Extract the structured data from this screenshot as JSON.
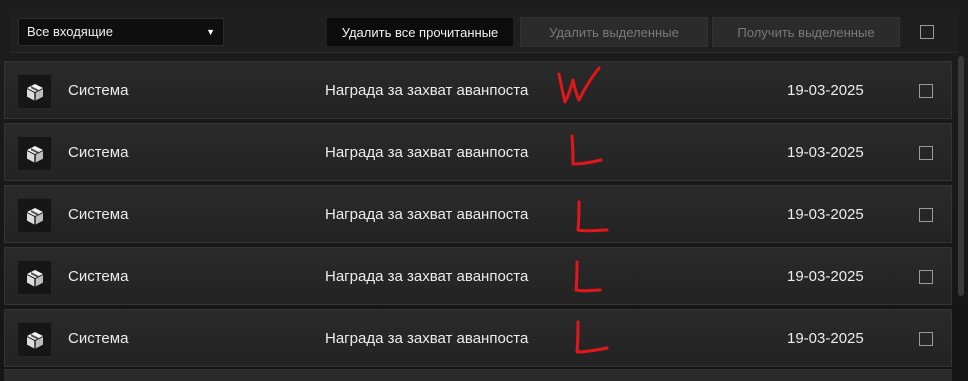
{
  "toolbar": {
    "filter": {
      "selected": "Все входящие"
    },
    "delete_read_label": "Удалить все прочитанные",
    "delete_selected_label": "Удалить выделенные",
    "receive_selected_label": "Получить выделенные"
  },
  "messages": [
    {
      "sender": "Система",
      "subject": "Награда за захват аванпоста",
      "date": "19-03-2025",
      "annotation": "W",
      "icon": "package-icon"
    },
    {
      "sender": "Система",
      "subject": "Награда за захват аванпоста",
      "date": "19-03-2025",
      "annotation": "L",
      "icon": "package-icon"
    },
    {
      "sender": "Система",
      "subject": "Награда за захват аванпоста",
      "date": "19-03-2025",
      "annotation": "L",
      "icon": "package-icon"
    },
    {
      "sender": "Система",
      "subject": "Награда за захват аванпоста",
      "date": "19-03-2025",
      "annotation": "L",
      "icon": "package-icon"
    },
    {
      "sender": "Система",
      "subject": "Награда за захват аванпоста",
      "date": "19-03-2025",
      "annotation": "L",
      "icon": "package-icon"
    }
  ],
  "colors": {
    "annotation": "#e3171b",
    "background": "#141414",
    "row": "#262626"
  }
}
